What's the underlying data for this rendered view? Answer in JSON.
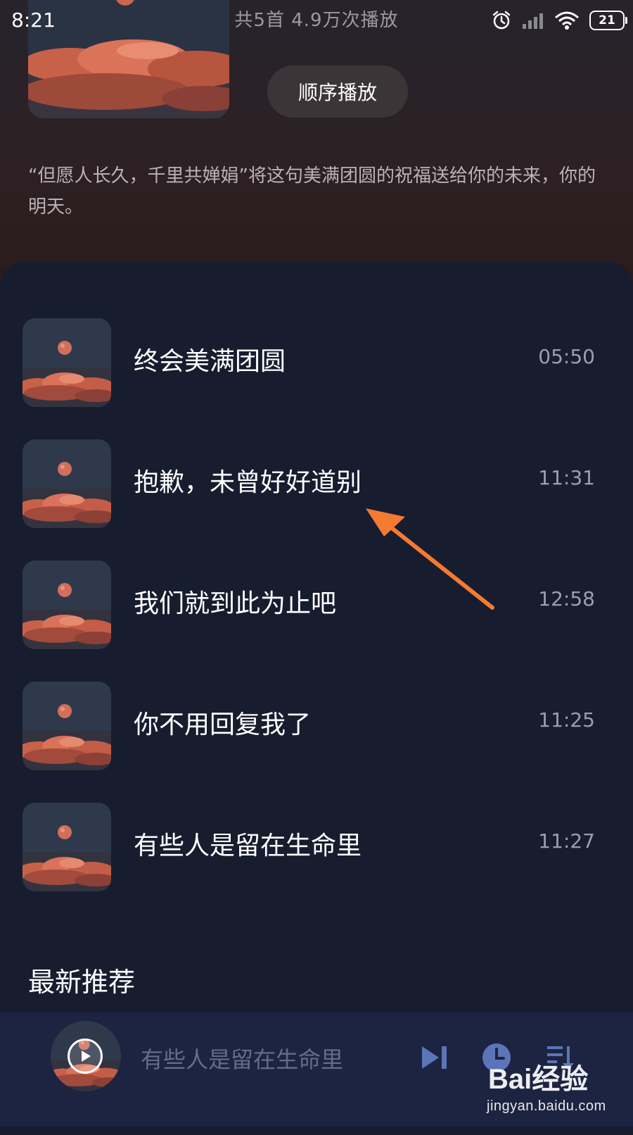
{
  "status_bar": {
    "time": "8:21",
    "battery": "21"
  },
  "playlist": {
    "stats": "共5首   4.9万次播放",
    "play_order_label": "顺序播放",
    "description": "“但愿人长久，千里共婵娟”将这句美满团圆的祝福送给你的未来，你的明天。"
  },
  "songs": [
    {
      "title": "终会美满团圆",
      "duration": "05:50"
    },
    {
      "title": "抱歉，未曾好好道别",
      "duration": "11:31"
    },
    {
      "title": "我们就到此为止吧",
      "duration": "12:58"
    },
    {
      "title": "你不用回复我了",
      "duration": "11:25"
    },
    {
      "title": "有些人是留在生命里",
      "duration": "11:27"
    }
  ],
  "section": {
    "latest_label": "最新推荐"
  },
  "mini_player": {
    "title": "有些人是留在生命里"
  },
  "watermark": {
    "brand": "Bai经验",
    "url": "jingyan.baidu.com"
  },
  "icons": {
    "alarm": "alarm-icon",
    "signal": "signal-icon",
    "wifi": "wifi-icon",
    "next": "skip-next-icon",
    "timer": "timer-clock-icon",
    "queue": "playlist-queue-icon",
    "annotation": "orange-arrow-annotation"
  },
  "colors": {
    "accent_arrow": "#f47a32",
    "panel_bg": "#171d2f",
    "player_bg": "#1c2442"
  }
}
